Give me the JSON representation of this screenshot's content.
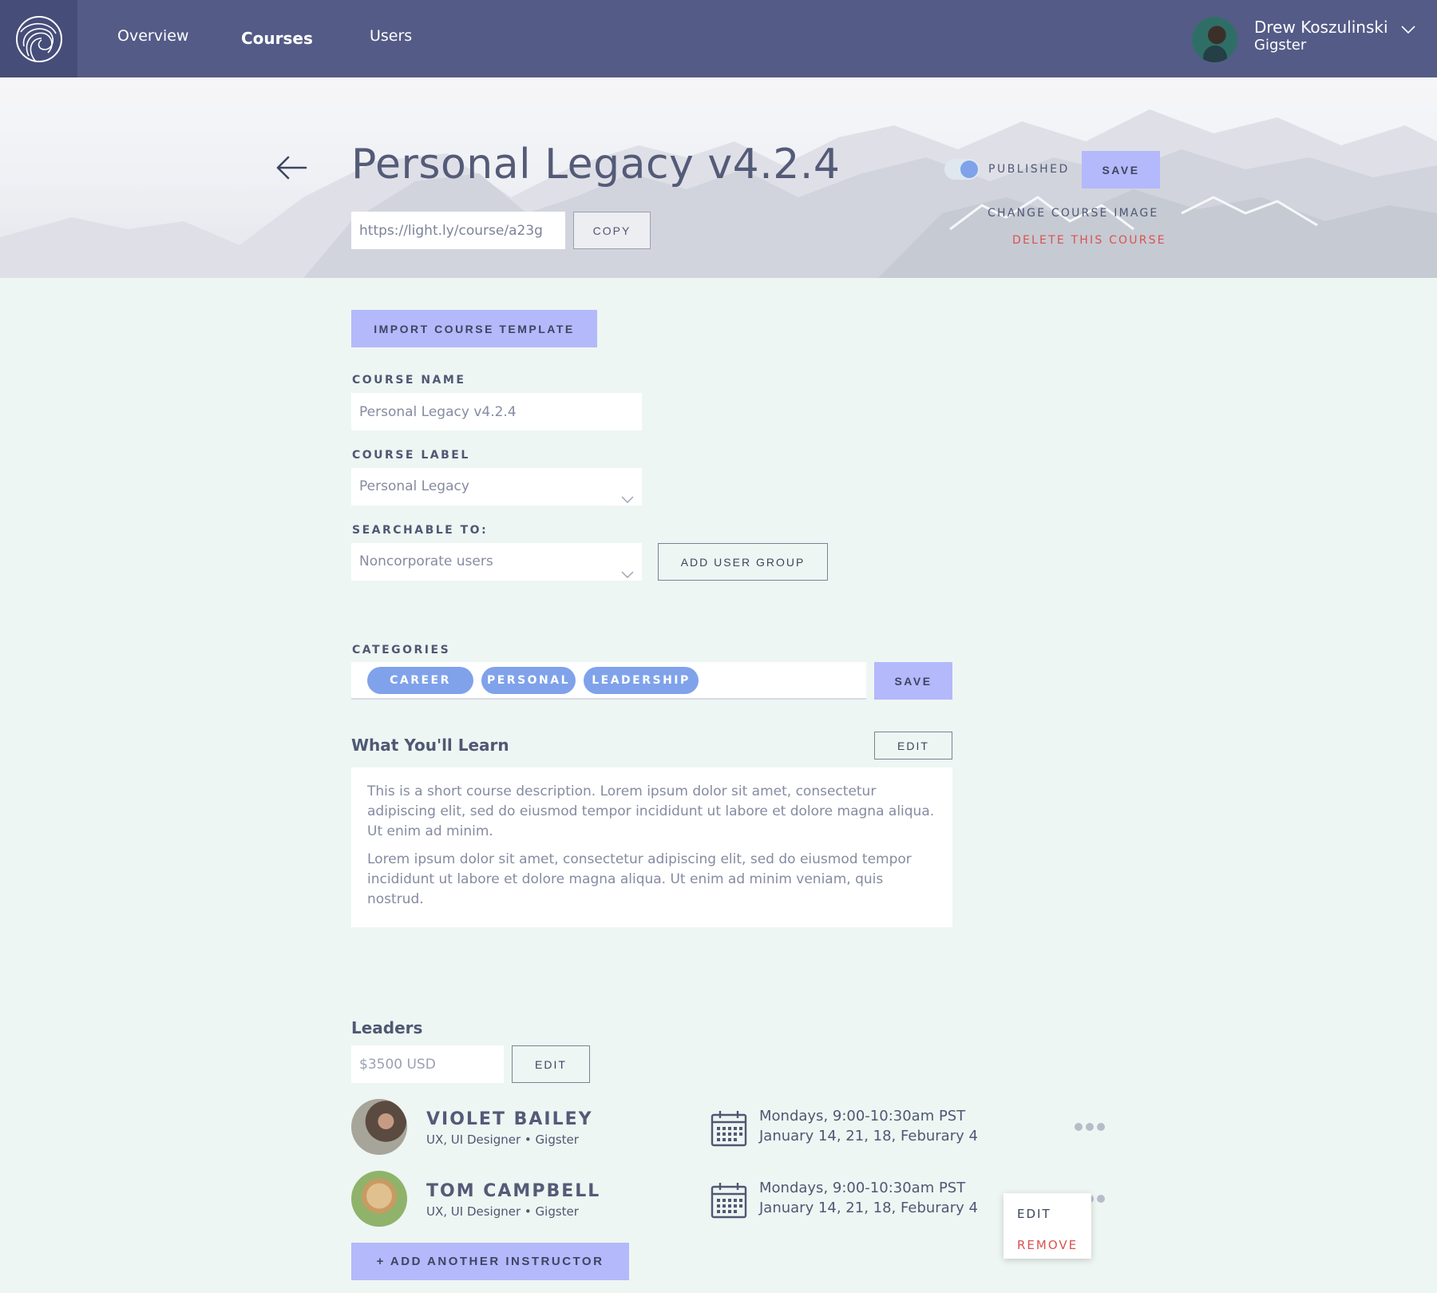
{
  "nav": {
    "links": [
      {
        "label": "Overview",
        "active": false
      },
      {
        "label": "Courses",
        "active": true
      },
      {
        "label": "Users",
        "active": false
      }
    ],
    "user": {
      "name": "Drew Koszulinski",
      "org": "Gigster"
    }
  },
  "hero": {
    "title": "Personal Legacy v4.2.4",
    "url": "https://light.ly/course/a23g",
    "copy_label": "COPY",
    "published_label": "PUBLISHED",
    "published": true,
    "save_label": "SAVE",
    "change_image_label": "CHANGE COURSE IMAGE",
    "delete_label": "DELETE THIS COURSE"
  },
  "form": {
    "import_label": "IMPORT COURSE TEMPLATE",
    "course_name_label": "COURSE NAME",
    "course_name_value": "Personal Legacy v4.2.4",
    "course_label_label": "COURSE LABEL",
    "course_label_value": "Personal Legacy",
    "searchable_label": "SEARCHABLE TO:",
    "searchable_value": "Noncorporate users",
    "add_group_label": "ADD USER GROUP",
    "categories_label": "CATEGORIES",
    "categories": [
      "CAREER",
      "PERSONAL",
      "LEADERSHIP"
    ],
    "categories_save_label": "SAVE"
  },
  "learn": {
    "title": "What You'll  Learn",
    "edit_label": "EDIT",
    "paragraphs": [
      "This is a short course description. Lorem ipsum dolor sit amet, consectetur adipiscing elit, sed do eiusmod tempor incididunt ut labore et dolore magna aliqua. Ut enim ad minim.",
      "Lorem ipsum dolor sit amet, consectetur adipiscing elit, sed do eiusmod tempor incididunt ut labore et dolore magna aliqua. Ut enim ad minim veniam, quis nostrud."
    ]
  },
  "leaders": {
    "title": "Leaders",
    "price": "$3500 USD",
    "edit_label": "EDIT",
    "list": [
      {
        "name": "VIOLET BAILEY",
        "role": "UX, UI Designer • Gigster",
        "schedule_line1": "Mondays, 9:00-10:30am PST",
        "schedule_line2": "January 14, 21, 18, Feburary 4"
      },
      {
        "name": "TOM CAMPBELL",
        "role": "UX, UI Designer • Gigster",
        "schedule_line1": "Mondays, 9:00-10:30am PST",
        "schedule_line2": "January 14, 21, 18, Feburary 4"
      }
    ],
    "menu": {
      "edit_label": "EDIT",
      "remove_label": "REMOVE"
    },
    "add_label": "+ ADD ANOTHER INSTRUCTOR"
  },
  "colors": {
    "nav_bg": "#545b87",
    "accent": "#b3b9fa",
    "chip": "#7fa2ea",
    "danger": "#d9534f",
    "page_bg": "#eef6f3"
  }
}
